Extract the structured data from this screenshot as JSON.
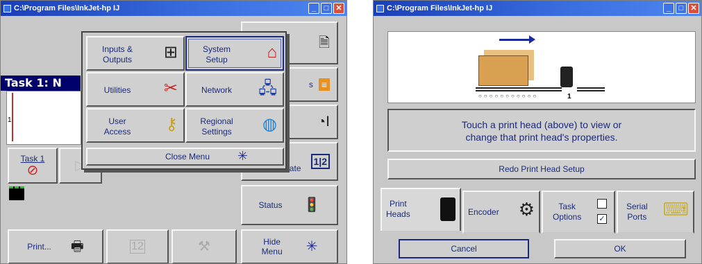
{
  "left_window": {
    "title": "C:\\Program Files\\InkJet-hp   IJ",
    "task_title": "Task 1: N",
    "task_line_number": "1",
    "task_button_label": "Task 1",
    "side_buttons": {
      "status": "Status",
      "date": "Date",
      "hide_menu": "Hide\nMenu",
      "partial_label": "s"
    },
    "bottom_buttons": {
      "print": "Print..."
    },
    "menu": {
      "items": [
        {
          "label": "Inputs &\nOutputs",
          "icon": "io-grid-icon"
        },
        {
          "label": "System\nSetup",
          "icon": "system-setup-icon"
        },
        {
          "label": "Utilities",
          "icon": "swiss-knife-icon"
        },
        {
          "label": "Network",
          "icon": "network-icon"
        },
        {
          "label": "User\nAccess",
          "icon": "keys-icon"
        },
        {
          "label": "Regional\nSettings",
          "icon": "globe-icon"
        }
      ],
      "close_label": "Close Menu"
    },
    "calendar_text": "1|2"
  },
  "right_window": {
    "title": "C:\\Program Files\\InkJet-hp   IJ",
    "print_head_number": "1",
    "info_text_line1": "Touch a print head (above) to view or",
    "info_text_line2": "change that print head's properties.",
    "redo_button": "Redo Print Head Setup",
    "tabs": [
      {
        "label": "Print\nHeads",
        "icon": "print-head-icon"
      },
      {
        "label": "Encoder",
        "icon": "encoder-wheel-icon"
      },
      {
        "label": "Task\nOptions",
        "icon": "checkbox-icon"
      },
      {
        "label": "Serial\nPorts",
        "icon": "serial-cable-icon"
      }
    ],
    "cancel_button": "Cancel",
    "ok_button": "OK"
  },
  "colors": {
    "title_bar": "#2a5ad0",
    "task_bar": "#00006b",
    "button_text": "#1a2a7a"
  }
}
